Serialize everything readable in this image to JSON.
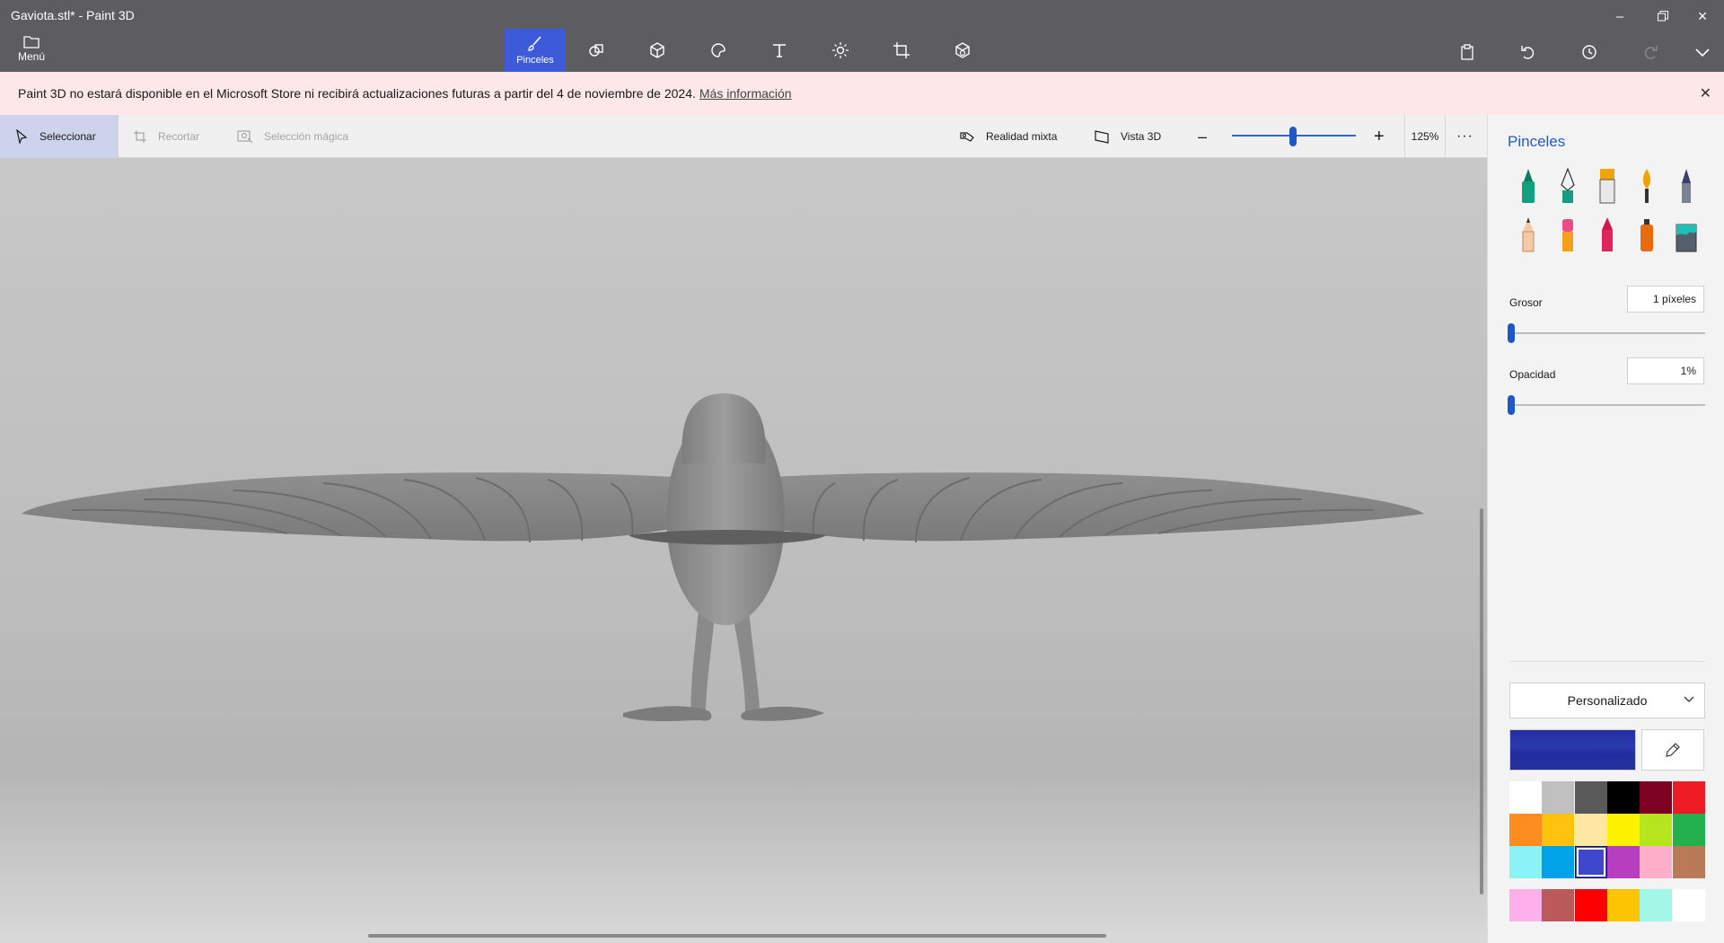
{
  "window": {
    "title": "Gaviota.stl* - Paint 3D"
  },
  "menu": {
    "label": "Menú"
  },
  "toolbar": {
    "active_label": "Pinceles"
  },
  "notice": {
    "text": "Paint 3D no estará disponible en el Microsoft Store ni recibirá actualizaciones futuras a partir del 4 de noviembre de 2024.",
    "link": "Más información"
  },
  "subbar": {
    "select": "Seleccionar",
    "crop": "Recortar",
    "magic_select": "Selección mágica",
    "mixed_reality": "Realidad mixta",
    "view3d": "Vista 3D",
    "zoom": "125%",
    "zoom_fraction": 0.5
  },
  "panel": {
    "title": "Pinceles",
    "thickness_label": "Grosor",
    "thickness_value": "1 píxeles",
    "opacity_label": "Opacidad",
    "opacity_value": "1%",
    "preset": "Personalizado",
    "current_color": "#232e9e"
  },
  "colors": {
    "palette": [
      "#ffffff",
      "#c0c0c0",
      "#595959",
      "#000000",
      "#7d0120",
      "#ee1c25",
      "#ff8c1f",
      "#ffc20e",
      "#ffe6a3",
      "#fff200",
      "#b5e61d",
      "#22b14c",
      "#8bf2f6",
      "#00a2e8",
      "#3f48cc",
      "#b83ec0",
      "#ffaec9",
      "#b97a57"
    ],
    "custom": [
      "#fdb0ea",
      "#bc5a5a",
      "#ff0000",
      "#fdc402",
      "#a3f7e6",
      "#ffffff"
    ],
    "selected_index": 14
  }
}
